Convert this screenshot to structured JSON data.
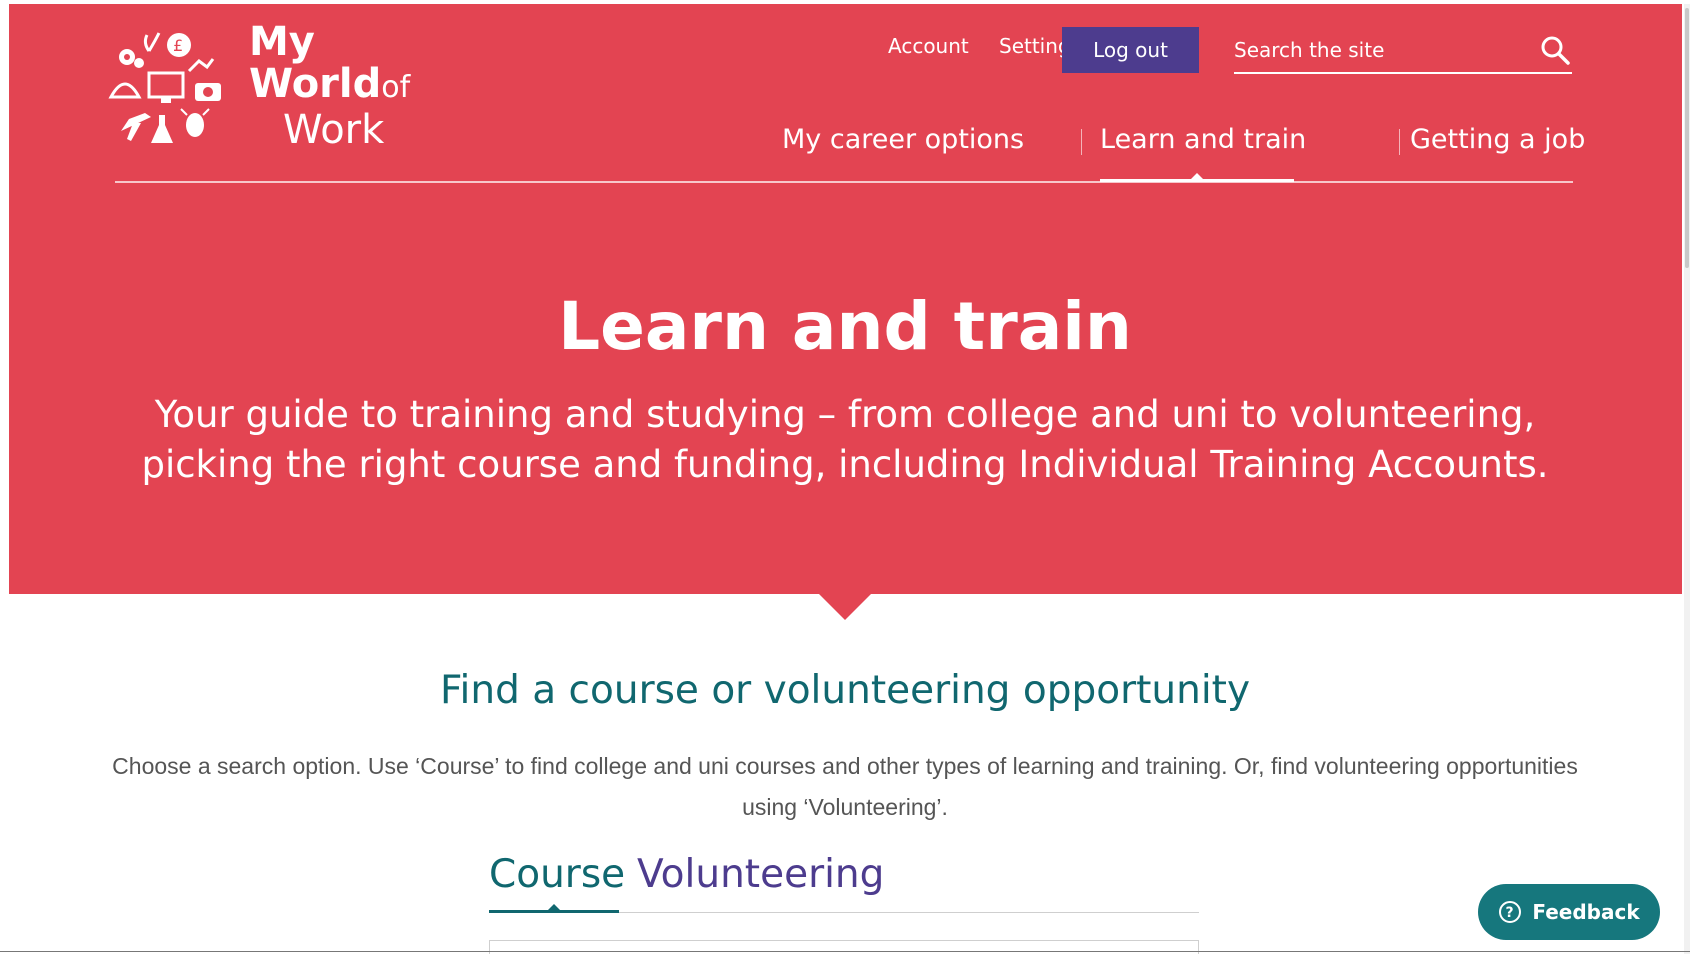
{
  "logo": {
    "line1": "My",
    "line2": "World",
    "of": "of",
    "line3": "Work"
  },
  "utility_nav": {
    "account": "Account",
    "settings": "Settings",
    "logout": "Log out",
    "search_placeholder": "Search the site"
  },
  "main_nav": {
    "items": [
      {
        "label": "My career options"
      },
      {
        "label": "Learn and train",
        "active": true
      },
      {
        "label": "Getting a job"
      }
    ]
  },
  "hero": {
    "title": "Learn and train",
    "subtitle": "Your guide to training and studying – from college and uni to volunteering, picking the right course and funding, including Individual Training Accounts."
  },
  "search_section": {
    "title": "Find a course or volunteering opportunity",
    "description": "Choose a search option. Use ‘Course’ to find college and uni courses and other types of learning and training. Or, find volunteering opportunities using ‘Volunteering’.",
    "tabs": [
      {
        "label": "Course",
        "active": true
      },
      {
        "label": "Volunteering"
      }
    ]
  },
  "feedback": {
    "label": "Feedback"
  },
  "colors": {
    "hero": "#e34452",
    "accent_purple": "#4d3c8e",
    "teal": "#10676f"
  }
}
